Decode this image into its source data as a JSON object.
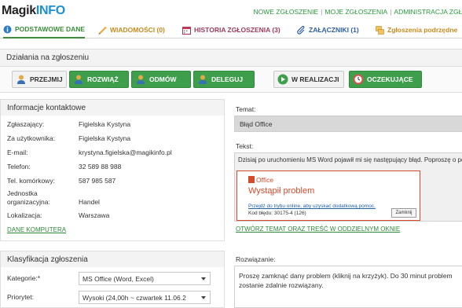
{
  "app": {
    "logo_main": "Magik",
    "logo_accent": "INFO"
  },
  "top_links": [
    "NOWE ZGŁOSZENIE",
    "MOJE ZGŁOSZENIA",
    "ADMINISTRACJA ZGŁE"
  ],
  "tabs": [
    {
      "label": "PODSTAWOWE DANE",
      "icon": "info-icon"
    },
    {
      "label": "WIADOMOŚCI (0)",
      "icon": "pencil-icon"
    },
    {
      "label": "HISTORIA ZGŁOSZENIA (3)",
      "icon": "calendar-icon"
    },
    {
      "label": "ZAŁĄCZNIKI (1)",
      "icon": "paperclip-icon"
    },
    {
      "label": "Zgłoszenia podrzędne",
      "icon": "stack-icon"
    }
  ],
  "actions": {
    "title": "Działania na zgłoszeniu",
    "buttons": {
      "take": "PRZEJMIJ",
      "resolve": "ROZWIĄŻ",
      "reject": "ODMÓW",
      "delegate": "DELEGUJ",
      "in_progress": "W REALIZACJI",
      "waiting": "OCZEKUJĄCE"
    }
  },
  "contact": {
    "title": "Informacje kontaktowe",
    "rows": [
      {
        "label": "Zgłaszający:",
        "value": "Figielska Kystyna"
      },
      {
        "label": "Za użytkownika:",
        "value": "Figielska Kystyna"
      },
      {
        "label": "E-mail:",
        "value": "krystyna.figielska@magikinfo.pl"
      },
      {
        "label": "Telefon:",
        "value": "32 589 88 988"
      },
      {
        "label": "Tel. komórkowy:",
        "value": "587 985 587"
      },
      {
        "label": "Jednostka organizacyjna:",
        "value": "Handel"
      },
      {
        "label": "Lokalizacja:",
        "value": "Warszawa"
      }
    ],
    "computer_link": "DANE KOMPUTERA"
  },
  "classification": {
    "title": "Klasyfikacja zgłoszenia",
    "category_label": "Kategorie:*",
    "category_value": "MS Office (Word, Excel)",
    "priority_label": "Priorytet:",
    "priority_value": "Wysoki (24,00h ~ czwartek 11.06.2"
  },
  "ticket": {
    "subject_label": "Temat:",
    "subject_value": "Błąd Office",
    "text_label": "Tekst:",
    "text_value": "Dzisiaj po uruchomieniu MS Word pojawił mi się następujący błąd. Poproszę o pom",
    "office_brand": "Office",
    "office_error": "Wystąpił problem",
    "office_link": "Przejdź do trybu online, aby uzyskać dodatkową pomoc.",
    "office_code": "Kod błędu: 30175-4 (126)",
    "office_close": "Zamknij",
    "open_link": "OTWÓRZ TEMAT ORAZ TREŚĆ W ODDZIELNYM OKNIE",
    "resolution_label": "Rozwiązanie:",
    "resolution_value": "Proszę zamknąć dany problem (kliknij na krzyżyk). Do 30 minut problem zostanie zdalnie rozwiązany."
  },
  "colors": {
    "accent_green": "#3e9e4b",
    "logo_blue": "#1a8fd1",
    "office_red": "#d54b2a"
  }
}
